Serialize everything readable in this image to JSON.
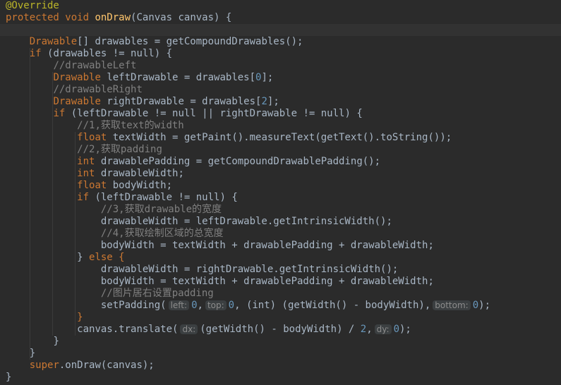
{
  "code": {
    "l1_annotation": "@Override",
    "l2_protected": "protected",
    "l2_void": "void",
    "l2_method": "onDraw",
    "l2_params": "(Canvas canvas) {",
    "l4_type": "Drawable",
    "l4_rest": "[] drawables = getCompoundDrawables();",
    "l5_if": "if",
    "l5_rest": "(drawables != null) {",
    "l6_comment": "//drawableLeft",
    "l7_type": "Drawable",
    "l7_rest": "leftDrawable = drawables[",
    "l7_index": "0",
    "l7_end": "];",
    "l8_comment": "//drawableRight",
    "l9_type": "Drawable",
    "l9_rest": "rightDrawable = drawables[",
    "l9_index": "2",
    "l9_end": "];",
    "l10_if": "if",
    "l10_rest": "(leftDrawable != null || rightDrawable != null) {",
    "l11_comment": "//1,获取text的width",
    "l12_float": "float",
    "l12_rest": "textWidth = getPaint().measureText(getText().toString());",
    "l13_comment": "//2,获取padding",
    "l14_int": "int",
    "l14_rest": "drawablePadding = getCompoundDrawablePadding();",
    "l15_int": "int",
    "l15_rest": "drawableWidth;",
    "l16_float": "float",
    "l16_rest": "bodyWidth;",
    "l17_if": "if",
    "l17_rest": "(leftDrawable != null) {",
    "l18_comment": "//3,获取drawable的宽度",
    "l19_text": "drawableWidth = leftDrawable.getIntrinsicWidth();",
    "l20_comment": "//4,获取绘制区域的总宽度",
    "l21_text": "bodyWidth = textWidth + drawablePadding + drawableWidth;",
    "l22_close": "} ",
    "l22_else": "else",
    "l22_brace": "{",
    "l23_text": "drawableWidth = rightDrawable.getIntrinsicWidth();",
    "l24_text": "bodyWidth = textWidth + drawablePadding + drawableWidth;",
    "l25_comment": "//图片居右设置padding",
    "l26_call": "setPadding(",
    "l26_hint_left": "left:",
    "l26_arg_left": "0",
    "l26_hint_top": "top:",
    "l26_arg_top": "0",
    "l26_int_cast": "(int)",
    "l26_mid": "(getWidth() - bodyWidth),",
    "l26_hint_bottom": "bottom:",
    "l26_arg_bottom": "0",
    "l26_end": ");",
    "l27_brace": "}",
    "l28_call": "canvas.translate(",
    "l28_hint_dx": "dx:",
    "l28_mid": "(getWidth() - bodyWidth) / ",
    "l28_num": "2",
    "l28_hint_dy": "dy:",
    "l28_num2": "0",
    "l28_end": ");",
    "l29_brace": "}",
    "l30_brace": "}",
    "l31_super": "super",
    "l31_rest": ".onDraw(canvas);",
    "l32_brace": "}"
  }
}
